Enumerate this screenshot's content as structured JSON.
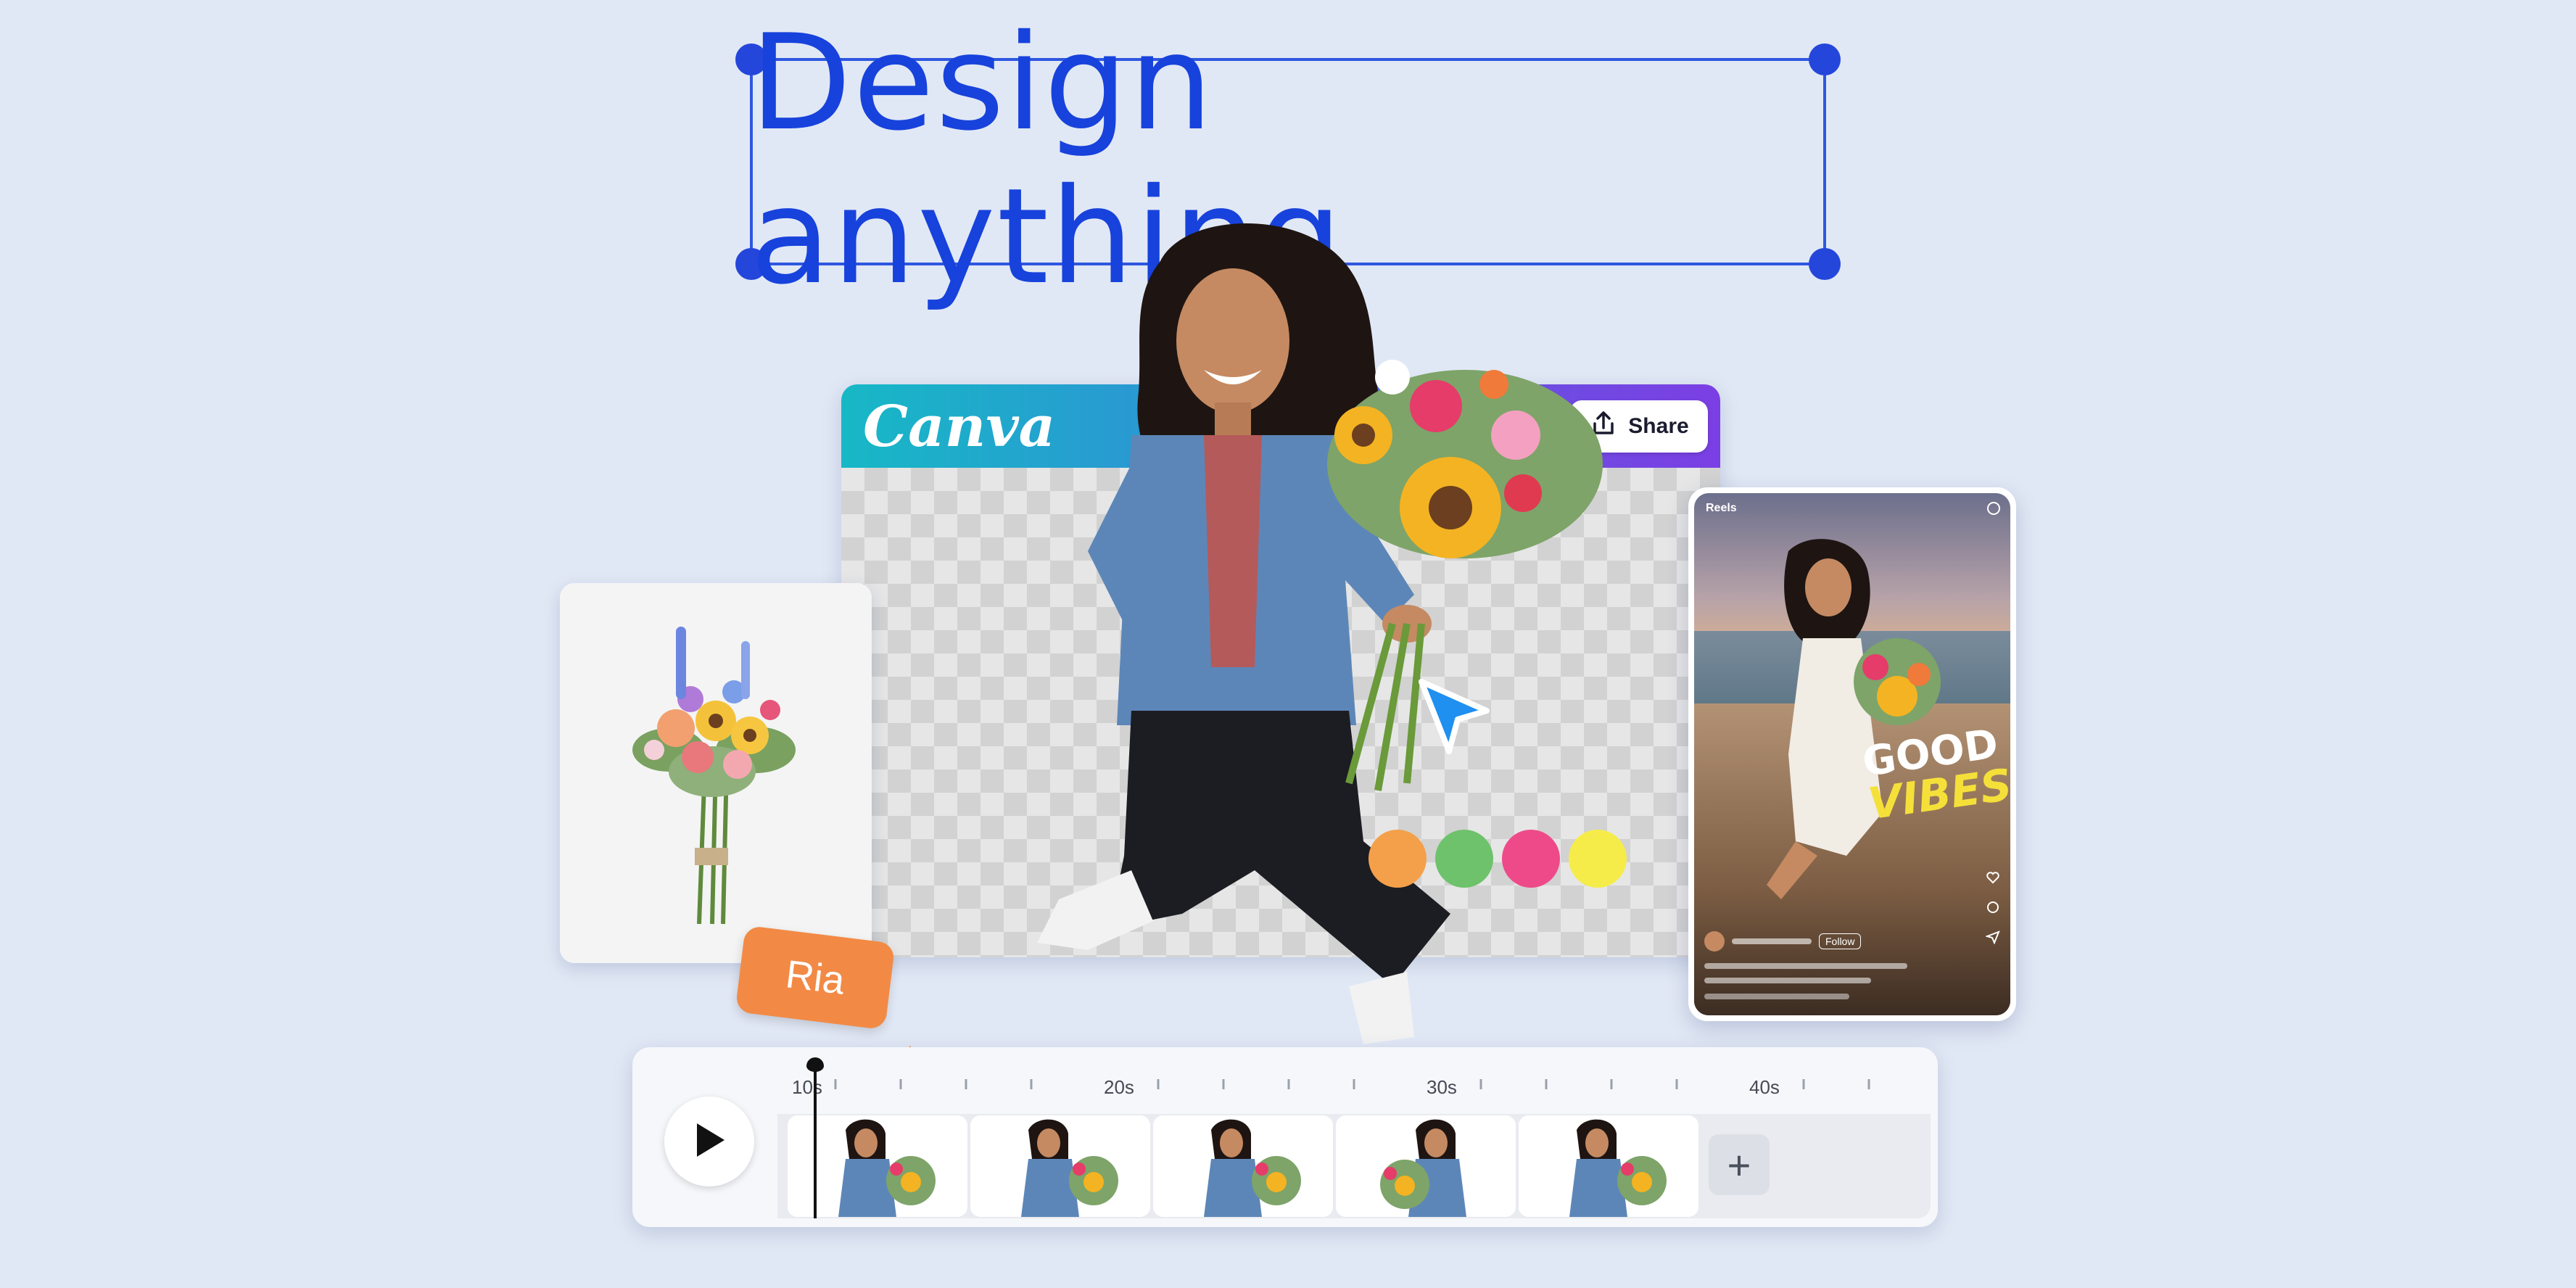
{
  "headline": {
    "text": "Design anything"
  },
  "editor": {
    "brand": "Canva",
    "share_label": "Share"
  },
  "reels": {
    "header": "Reels",
    "overlay_line1": "GOOD",
    "overlay_line2": "VIBES",
    "follow_label": "Follow"
  },
  "swatches": [
    "#f4a04a",
    "#6ec26b",
    "#ee4a8a",
    "#f5ec4a"
  ],
  "name_tag": {
    "text": "Ria"
  },
  "timeline": {
    "ticks": [
      "10s",
      "20s",
      "30s",
      "40s"
    ],
    "add_label": "+"
  },
  "icons": {
    "share": "share-icon",
    "play": "play-icon",
    "cursor": "cursor-arrow-icon",
    "add": "plus-icon"
  },
  "colors": {
    "background": "#e1e8f5",
    "accent_blue": "#1742dc",
    "selection_handle": "#2446db",
    "tag_orange": "#f28a45"
  }
}
